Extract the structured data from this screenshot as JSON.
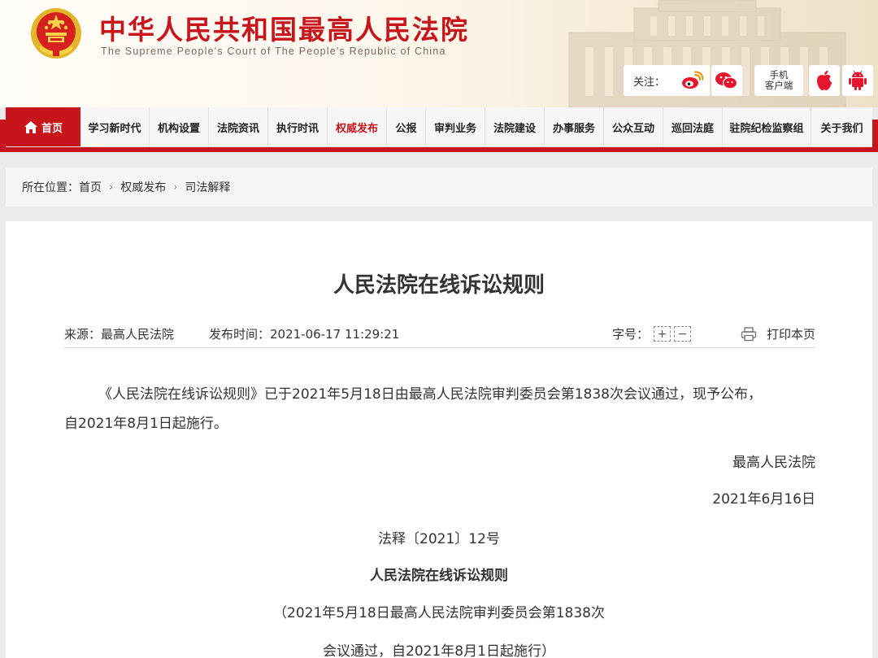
{
  "header": {
    "title": "中华人民共和国最高人民法院",
    "subtitle": "The Supreme People's Court of The People's Republic of China",
    "follow_label": "关注：",
    "mobile_client_line1": "手机",
    "mobile_client_line2": "客户端",
    "icons": [
      "weibo-icon",
      "wechat-icon",
      "apple-icon",
      "android-icon"
    ]
  },
  "nav": {
    "items": [
      {
        "label": "首页"
      },
      {
        "label": "学习新时代"
      },
      {
        "label": "机构设置"
      },
      {
        "label": "法院资讯"
      },
      {
        "label": "执行时讯"
      },
      {
        "label": "权威发布"
      },
      {
        "label": "公报"
      },
      {
        "label": "审判业务"
      },
      {
        "label": "法院建设"
      },
      {
        "label": "办事服务"
      },
      {
        "label": "公众互动"
      },
      {
        "label": "巡回法庭"
      },
      {
        "label": "驻院纪检监察组"
      },
      {
        "label": "关于我们"
      }
    ],
    "active_label": "权威发布"
  },
  "breadcrumb": {
    "prefix": "所在位置：",
    "items": [
      "首页",
      "权威发布",
      "司法解释"
    ]
  },
  "article": {
    "title": "人民法院在线诉讼规则",
    "source": "来源：最高人民法院",
    "publish_time": "发布时间：2021-06-17 11:29:21",
    "font_size_label": "字号：",
    "font_plus": "+",
    "font_minus": "−",
    "print_label": "打印本页",
    "paragraph_line1": "《人民法院在线诉讼规则》已于2021年5月18日由最高人民法院审判委员会第1838次会议通过，现予公布，",
    "paragraph_line2": "自2021年8月1日起施行。",
    "signature_court": "最高人民法院",
    "signature_date": "2021年6月16日",
    "doc_number": "法释〔2021〕12号",
    "doc_title": "人民法院在线诉讼规则",
    "doc_note_line1": "（2021年5月18日最高人民法院审判委员会第1838次",
    "doc_note_line2": "会议通过，自2021年8月1日起施行）"
  },
  "colors": {
    "brand_red": "#c8141b",
    "nav_bg": "#f7f7f7",
    "page_bg": "#ececec"
  }
}
